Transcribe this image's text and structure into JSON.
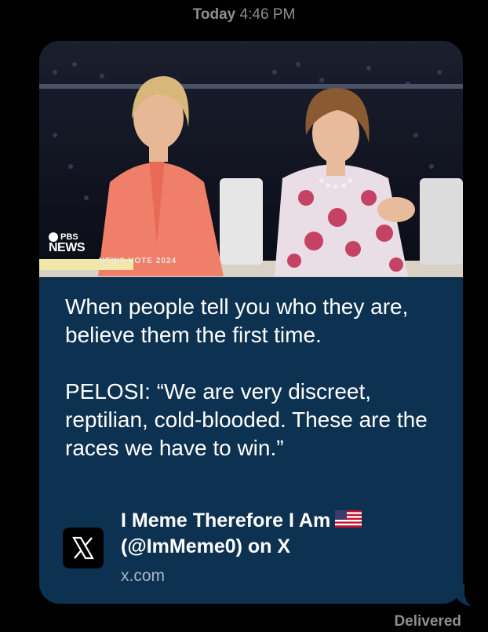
{
  "header": {
    "day": "Today",
    "time": "4:46 PM"
  },
  "message": {
    "preview_image": {
      "description_icon": "news-broadcast-photo",
      "logo_top": "PBS",
      "logo_bottom": "NEWS",
      "banner": "NEWS VOTE 2024"
    },
    "body": "When people tell you who they are, believe them the first time.\n\nPELOSI: “We are very discreet, reptilian, cold-blooded. These are the races we have to win.”",
    "link": {
      "icon": "x-logo-icon",
      "title_line1": "I Meme Therefore I Am",
      "title_line2": "(@ImMeme0) on X",
      "domain": "x.com"
    },
    "bubble_color": "#0d3251"
  },
  "status": {
    "delivered": "Delivered"
  }
}
